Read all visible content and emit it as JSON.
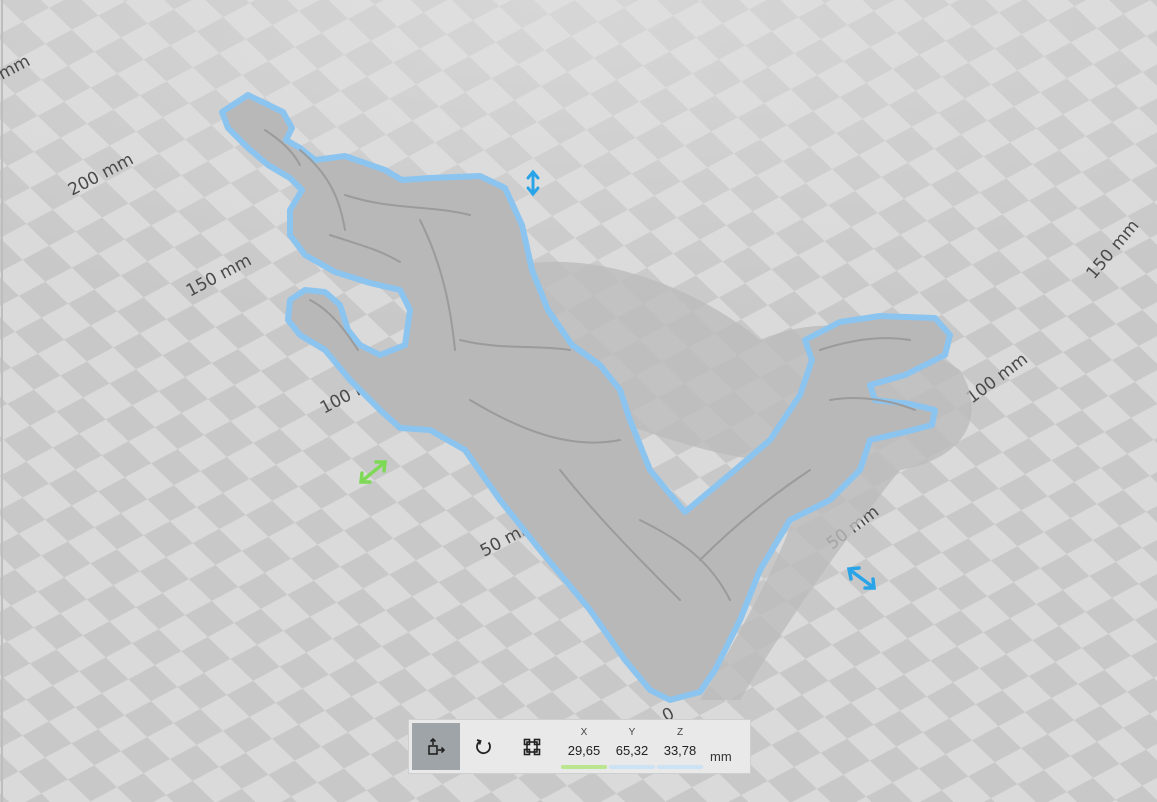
{
  "bed": {
    "labels": [
      {
        "id": "left-200",
        "text": "200 mm"
      },
      {
        "id": "left-150",
        "text": "150 mm"
      },
      {
        "id": "left-100",
        "text": "100 mm"
      },
      {
        "id": "left-50",
        "text": "50 mm"
      },
      {
        "id": "origin",
        "text": "0"
      },
      {
        "id": "right-50",
        "text": "50 mm"
      },
      {
        "id": "right-100",
        "text": "100 mm"
      },
      {
        "id": "right-150",
        "text": "150 mm"
      },
      {
        "id": "corner",
        "text": "mm"
      }
    ],
    "colors": {
      "checker_light": "#dadada",
      "checker_dark": "#c6c6c6",
      "selection_outline": "#8cc4f0",
      "arrow_blue": "#2aa4e8",
      "arrow_green": "#7ed957"
    }
  },
  "model": {
    "name": "figure-model",
    "selected": true
  },
  "toolbar": {
    "tools": [
      {
        "name": "move-tool",
        "icon": "move-icon",
        "active": true
      },
      {
        "name": "rotate-tool",
        "icon": "rotate-icon",
        "active": false
      },
      {
        "name": "scale-tool",
        "icon": "scale-icon",
        "active": false
      }
    ],
    "x": {
      "label": "X",
      "value": "29,65",
      "color": "#b9e68f"
    },
    "y": {
      "label": "Y",
      "value": "65,32",
      "color": "#cbe3f4"
    },
    "z": {
      "label": "Z",
      "value": "33,78",
      "color": "#cbe3f4"
    },
    "unit": "mm"
  }
}
